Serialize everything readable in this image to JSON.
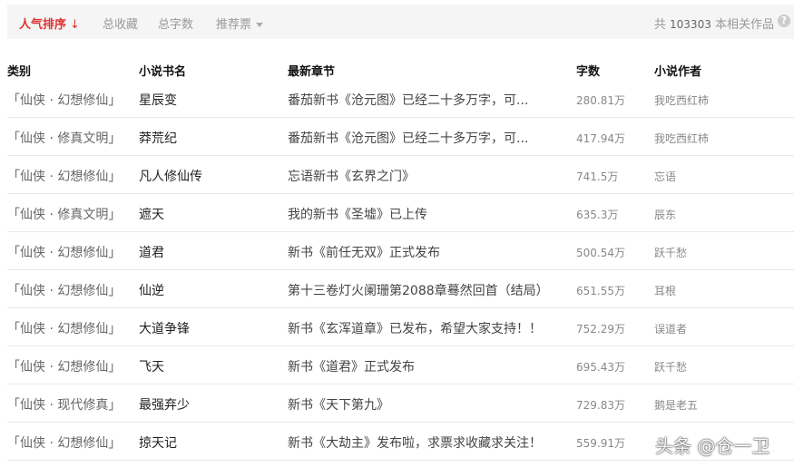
{
  "toolbar": {
    "tabs": [
      {
        "label": "人气排序",
        "active": true,
        "arrow": "↓"
      },
      {
        "label": "总收藏"
      },
      {
        "label": "总字数"
      },
      {
        "label": "推荐票"
      }
    ],
    "total_prefix": "共",
    "total_count": "103303",
    "total_suffix": "本相关作品",
    "help": "?"
  },
  "columns": [
    "类别",
    "小说书名",
    "最新章节",
    "字数",
    "小说作者"
  ],
  "rows": [
    {
      "category": "「仙侠 · 幻想修仙」",
      "name": "星辰变",
      "chapter": "番茄新书《沧元图》已经二十多万字，可...",
      "words": "280.81万",
      "author": "我吃西红柿"
    },
    {
      "category": "「仙侠 · 修真文明」",
      "name": "莽荒纪",
      "chapter": "番茄新书《沧元图》已经二十多万字，可...",
      "words": "417.94万",
      "author": "我吃西红柿"
    },
    {
      "category": "「仙侠 · 幻想修仙」",
      "name": "凡人修仙传",
      "chapter": "忘语新书《玄界之门》",
      "words": "741.5万",
      "author": "忘语"
    },
    {
      "category": "「仙侠 · 修真文明」",
      "name": "遮天",
      "chapter": "我的新书《圣墟》已上传",
      "words": "635.3万",
      "author": "辰东"
    },
    {
      "category": "「仙侠 · 幻想修仙」",
      "name": "道君",
      "chapter": "新书《前任无双》正式发布",
      "words": "500.54万",
      "author": "跃千愁"
    },
    {
      "category": "「仙侠 · 幻想修仙」",
      "name": "仙逆",
      "chapter": "第十三卷灯火阑珊第2088章蓦然回首（结局）",
      "words": "651.55万",
      "author": "耳根"
    },
    {
      "category": "「仙侠 · 幻想修仙」",
      "name": "大道争锋",
      "chapter": "新书《玄浑道章》已发布，希望大家支持！！",
      "words": "752.29万",
      "author": "误道者"
    },
    {
      "category": "「仙侠 · 幻想修仙」",
      "name": "飞天",
      "chapter": "新书《道君》正式发布",
      "words": "695.43万",
      "author": "跃千愁"
    },
    {
      "category": "「仙侠 · 现代修真」",
      "name": "最强弃少",
      "chapter": "新书《天下第九》",
      "words": "729.83万",
      "author": "鹅是老五"
    },
    {
      "category": "「仙侠 · 幻想修仙」",
      "name": "掠天记",
      "chapter": "新书《大劫主》发布啦，求票求收藏求关注！",
      "words": "559.91万",
      "author": ""
    }
  ],
  "watermark": "头条 @仓一卫"
}
